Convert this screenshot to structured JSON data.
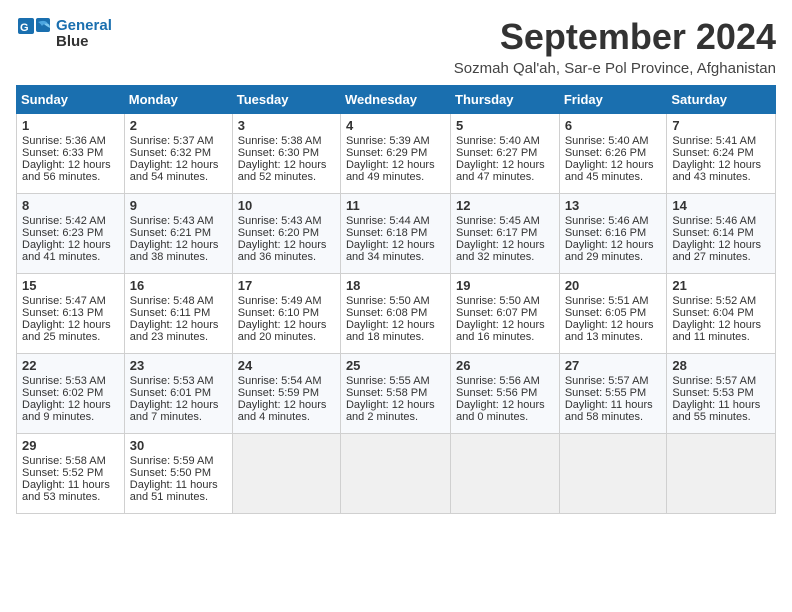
{
  "header": {
    "logo_line1": "General",
    "logo_line2": "Blue",
    "month_title": "September 2024",
    "subtitle": "Sozmah Qal'ah, Sar-e Pol Province, Afghanistan"
  },
  "weekdays": [
    "Sunday",
    "Monday",
    "Tuesday",
    "Wednesday",
    "Thursday",
    "Friday",
    "Saturday"
  ],
  "weeks": [
    [
      {
        "day": "1",
        "sunrise": "5:36 AM",
        "sunset": "6:33 PM",
        "daylight": "12 hours and 56 minutes."
      },
      {
        "day": "2",
        "sunrise": "5:37 AM",
        "sunset": "6:32 PM",
        "daylight": "12 hours and 54 minutes."
      },
      {
        "day": "3",
        "sunrise": "5:38 AM",
        "sunset": "6:30 PM",
        "daylight": "12 hours and 52 minutes."
      },
      {
        "day": "4",
        "sunrise": "5:39 AM",
        "sunset": "6:29 PM",
        "daylight": "12 hours and 49 minutes."
      },
      {
        "day": "5",
        "sunrise": "5:40 AM",
        "sunset": "6:27 PM",
        "daylight": "12 hours and 47 minutes."
      },
      {
        "day": "6",
        "sunrise": "5:40 AM",
        "sunset": "6:26 PM",
        "daylight": "12 hours and 45 minutes."
      },
      {
        "day": "7",
        "sunrise": "5:41 AM",
        "sunset": "6:24 PM",
        "daylight": "12 hours and 43 minutes."
      }
    ],
    [
      {
        "day": "8",
        "sunrise": "5:42 AM",
        "sunset": "6:23 PM",
        "daylight": "12 hours and 41 minutes."
      },
      {
        "day": "9",
        "sunrise": "5:43 AM",
        "sunset": "6:21 PM",
        "daylight": "12 hours and 38 minutes."
      },
      {
        "day": "10",
        "sunrise": "5:43 AM",
        "sunset": "6:20 PM",
        "daylight": "12 hours and 36 minutes."
      },
      {
        "day": "11",
        "sunrise": "5:44 AM",
        "sunset": "6:18 PM",
        "daylight": "12 hours and 34 minutes."
      },
      {
        "day": "12",
        "sunrise": "5:45 AM",
        "sunset": "6:17 PM",
        "daylight": "12 hours and 32 minutes."
      },
      {
        "day": "13",
        "sunrise": "5:46 AM",
        "sunset": "6:16 PM",
        "daylight": "12 hours and 29 minutes."
      },
      {
        "day": "14",
        "sunrise": "5:46 AM",
        "sunset": "6:14 PM",
        "daylight": "12 hours and 27 minutes."
      }
    ],
    [
      {
        "day": "15",
        "sunrise": "5:47 AM",
        "sunset": "6:13 PM",
        "daylight": "12 hours and 25 minutes."
      },
      {
        "day": "16",
        "sunrise": "5:48 AM",
        "sunset": "6:11 PM",
        "daylight": "12 hours and 23 minutes."
      },
      {
        "day": "17",
        "sunrise": "5:49 AM",
        "sunset": "6:10 PM",
        "daylight": "12 hours and 20 minutes."
      },
      {
        "day": "18",
        "sunrise": "5:50 AM",
        "sunset": "6:08 PM",
        "daylight": "12 hours and 18 minutes."
      },
      {
        "day": "19",
        "sunrise": "5:50 AM",
        "sunset": "6:07 PM",
        "daylight": "12 hours and 16 minutes."
      },
      {
        "day": "20",
        "sunrise": "5:51 AM",
        "sunset": "6:05 PM",
        "daylight": "12 hours and 13 minutes."
      },
      {
        "day": "21",
        "sunrise": "5:52 AM",
        "sunset": "6:04 PM",
        "daylight": "12 hours and 11 minutes."
      }
    ],
    [
      {
        "day": "22",
        "sunrise": "5:53 AM",
        "sunset": "6:02 PM",
        "daylight": "12 hours and 9 minutes."
      },
      {
        "day": "23",
        "sunrise": "5:53 AM",
        "sunset": "6:01 PM",
        "daylight": "12 hours and 7 minutes."
      },
      {
        "day": "24",
        "sunrise": "5:54 AM",
        "sunset": "5:59 PM",
        "daylight": "12 hours and 4 minutes."
      },
      {
        "day": "25",
        "sunrise": "5:55 AM",
        "sunset": "5:58 PM",
        "daylight": "12 hours and 2 minutes."
      },
      {
        "day": "26",
        "sunrise": "5:56 AM",
        "sunset": "5:56 PM",
        "daylight": "12 hours and 0 minutes."
      },
      {
        "day": "27",
        "sunrise": "5:57 AM",
        "sunset": "5:55 PM",
        "daylight": "11 hours and 58 minutes."
      },
      {
        "day": "28",
        "sunrise": "5:57 AM",
        "sunset": "5:53 PM",
        "daylight": "11 hours and 55 minutes."
      }
    ],
    [
      {
        "day": "29",
        "sunrise": "5:58 AM",
        "sunset": "5:52 PM",
        "daylight": "11 hours and 53 minutes."
      },
      {
        "day": "30",
        "sunrise": "5:59 AM",
        "sunset": "5:50 PM",
        "daylight": "11 hours and 51 minutes."
      },
      null,
      null,
      null,
      null,
      null
    ]
  ],
  "labels": {
    "sunrise": "Sunrise:",
    "sunset": "Sunset:",
    "daylight": "Daylight:"
  }
}
